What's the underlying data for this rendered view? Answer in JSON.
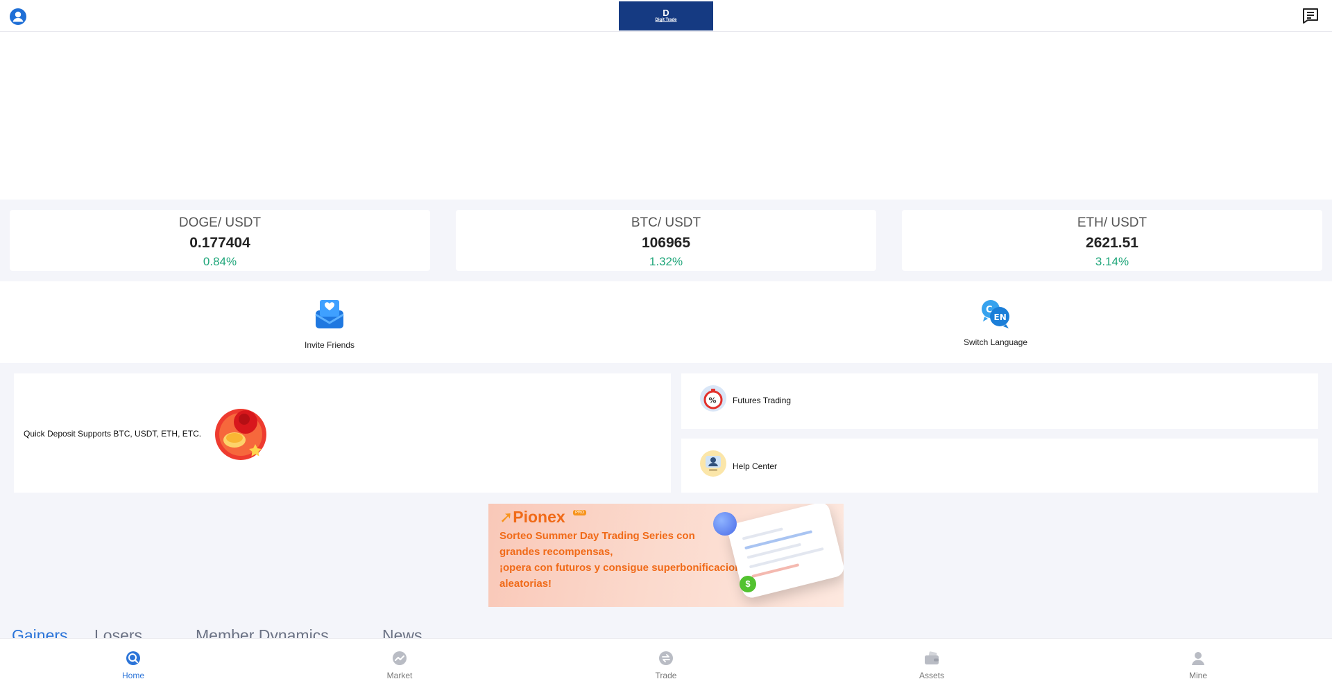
{
  "header": {
    "logo_mark": "D",
    "logo_name": "Digit Trade",
    "icons": {
      "user": "user-avatar-icon",
      "messages": "message-icon"
    }
  },
  "tickers": [
    {
      "pair": "DOGE/ USDT",
      "price": "0.177404",
      "change": "0.84%"
    },
    {
      "pair": "BTC/ USDT",
      "price": "106965",
      "change": "1.32%"
    },
    {
      "pair": "ETH/ USDT",
      "price": "2621.51",
      "change": "3.14%"
    }
  ],
  "shortcuts": {
    "invite": {
      "label": "Invite Friends",
      "icon": "invite-mail-icon"
    },
    "language": {
      "label": "Switch Language",
      "icon": "language-icon",
      "badge": "EN"
    }
  },
  "cards": {
    "deposit": {
      "label": "Quick Deposit Supports BTC, USDT, ETH, ETC."
    },
    "futures": {
      "label": "Futures Trading"
    },
    "help": {
      "label": "Help Center"
    }
  },
  "promo": {
    "brand": "Pionex",
    "brand_tag": "PRO",
    "lines": [
      "Sorteo Summer Day Trading Series con",
      "grandes recompensas,",
      "¡opera con futuros y consigue superbonificaciones",
      "aleatorias!"
    ]
  },
  "tabs": [
    {
      "label": "Gainers",
      "active": true
    },
    {
      "label": "Losers",
      "active": false
    },
    {
      "label": "Member Dynamics",
      "active": false
    },
    {
      "label": "News",
      "active": false
    }
  ],
  "bottom_nav": [
    {
      "label": "Home",
      "active": true,
      "icon": "home-icon"
    },
    {
      "label": "Market",
      "active": false,
      "icon": "market-icon"
    },
    {
      "label": "Trade",
      "active": false,
      "icon": "trade-icon"
    },
    {
      "label": "Assets",
      "active": false,
      "icon": "assets-wallet-icon"
    },
    {
      "label": "Mine",
      "active": false,
      "icon": "mine-user-icon"
    }
  ],
  "colors": {
    "accent": "#2b74d8",
    "positive": "#1fa67a",
    "logo_bg": "#153a82",
    "promo_text": "#f06a18"
  }
}
